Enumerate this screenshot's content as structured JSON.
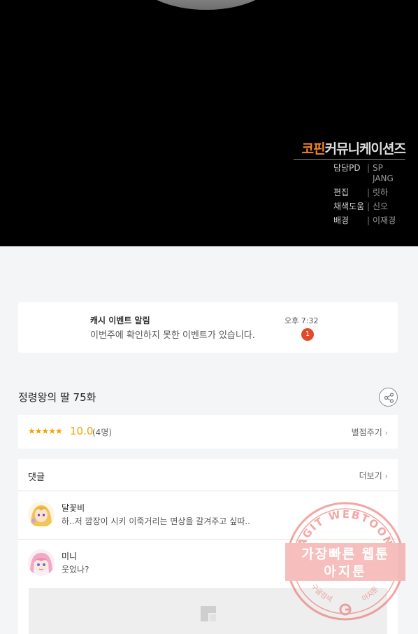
{
  "comic": {
    "brand_a": "코핀",
    "brand_b": "커뮤니케이션즈",
    "credits": [
      {
        "role": "담당PD",
        "name": "SP JANG"
      },
      {
        "role": "편집",
        "name": "릿하"
      },
      {
        "role": "채색도움",
        "name": "신오"
      },
      {
        "role": "배경",
        "name": "이재경"
      }
    ],
    "separator": "|"
  },
  "notification": {
    "title": "캐시 이벤트 알림",
    "time": "오후 7:32",
    "body": "이번주에 확인하지 못한 이벤트가 있습니다.",
    "badge": "1"
  },
  "episode": {
    "title": "정령왕의 딸 75화",
    "share_icon": "share-icon"
  },
  "rating": {
    "stars": "★★★★★",
    "score": "10.0",
    "count": "(4명)",
    "rate_label": "별점주기",
    "star_color": "#f0a300"
  },
  "comments": {
    "label": "댓글",
    "more_label": "더보기",
    "items": [
      {
        "name": "달꽃비",
        "text": "하..저 깜장이 시키 이죽거리는 면상을 갈겨주고 싶따..",
        "avatar": "avatar-blonde-girl"
      },
      {
        "name": "미니",
        "text": "웃었나?",
        "avatar": "avatar-pink-hair-girl"
      }
    ],
    "image_placeholder_icon": "image-placeholder-icon"
  },
  "watermark": {
    "ring_text": "AGIT WEBTOON",
    "line1": "가장빠른 웹툰",
    "line2": "아지툰",
    "bottom_left": "구글검색",
    "bottom_right": "아지툰",
    "color": "#e8605a"
  },
  "chevron": "›"
}
